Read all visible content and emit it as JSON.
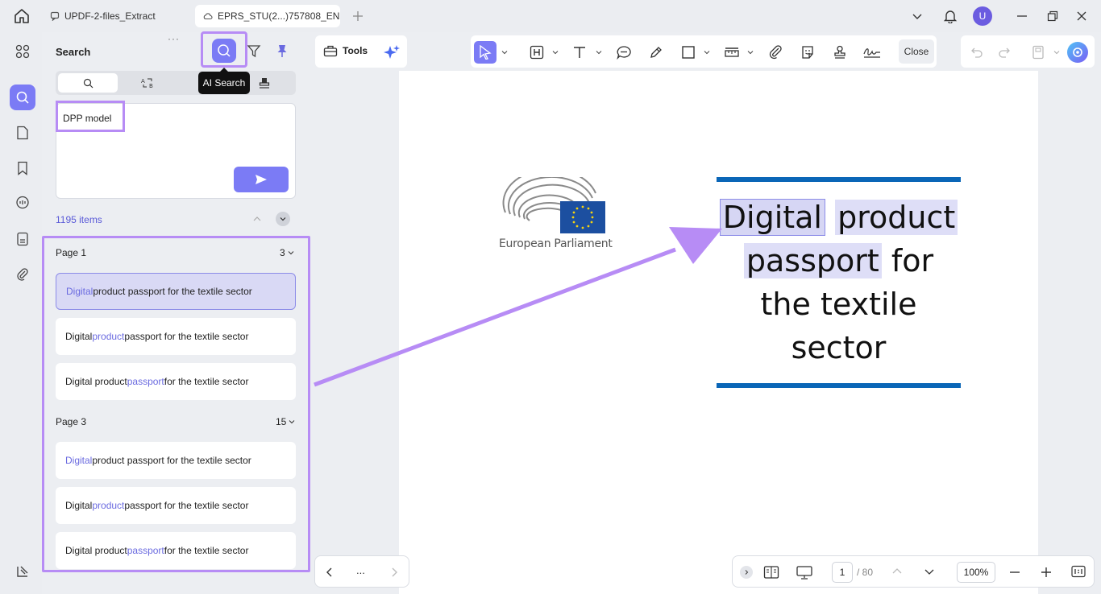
{
  "tabs": [
    {
      "label": "UPDF-2-files_Extract"
    },
    {
      "label": "EPRS_STU(2...)757808_EN"
    }
  ],
  "avatar_letter": "U",
  "panel": {
    "title": "Search",
    "tooltip": "AI Search",
    "query": "DPP model",
    "items_count": "1195 items"
  },
  "groups": [
    {
      "page": "Page 1",
      "count": "3",
      "results": [
        {
          "pre": "",
          "match": "Digital",
          "post": " product passport for the textile sector",
          "selected": true
        },
        {
          "pre": "Digital ",
          "match": "product",
          "post": " passport for the textile sector"
        },
        {
          "pre": "Digital product ",
          "match": "passport",
          "post": " for the textile sector"
        }
      ]
    },
    {
      "page": "Page 3",
      "count": "15",
      "results": [
        {
          "pre": "",
          "match": "Digital",
          "post": " product passport for the textile sector"
        },
        {
          "pre": "Digital ",
          "match": "product",
          "post": " passport for the textile sector"
        },
        {
          "pre": "Digital product ",
          "match": "passport",
          "post": " for the textile sector"
        }
      ]
    }
  ],
  "toolbar": {
    "tools_label": "Tools",
    "close_label": "Close"
  },
  "document": {
    "logo_text": "European Parliament",
    "title_w1": "Digital",
    "title_w2": "product",
    "title_w3": "passport",
    "title_w4": "for",
    "title_line3": "the textile",
    "title_line4": "sector"
  },
  "pager": {
    "current": "1",
    "total": "/ 80",
    "zoom": "100%",
    "more": "..."
  },
  "colors": {
    "accent": "#7b7bf5",
    "highlight_frame": "#b78cf5",
    "doc_rule": "#0a66b7"
  }
}
